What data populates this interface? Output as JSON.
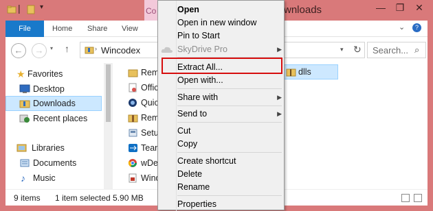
{
  "window": {
    "title": "Downloads",
    "title_visible_fragment": "wnloads",
    "context_tab_fragment": "Co"
  },
  "ribbon": {
    "tabs": [
      {
        "label": "File"
      },
      {
        "label": "Home"
      },
      {
        "label": "Share"
      },
      {
        "label": "View"
      }
    ]
  },
  "address": {
    "path": "Wincodex",
    "search_placeholder": "Search..."
  },
  "nav": {
    "favorites_label": "Favorites",
    "items": [
      {
        "label": "Desktop",
        "icon": "desktop-icon"
      },
      {
        "label": "Downloads",
        "icon": "downloads-folder-icon",
        "selected": true
      },
      {
        "label": "Recent places",
        "icon": "recent-places-icon"
      }
    ],
    "libraries_label": "Libraries",
    "library_items": [
      {
        "label": "Documents",
        "icon": "documents-icon"
      },
      {
        "label": "Music",
        "icon": "music-icon"
      }
    ]
  },
  "files": [
    {
      "label": "Rem",
      "icon": "folder-icon"
    },
    {
      "label": "Offic",
      "icon": "office-installer-icon"
    },
    {
      "label": "Quic",
      "icon": "quicktime-icon"
    },
    {
      "label": "Rem",
      "icon": "archive-icon"
    },
    {
      "label": "Setu",
      "icon": "setup-icon"
    },
    {
      "label": "Tean",
      "icon": "teamviewer-icon"
    },
    {
      "label": "wDe",
      "icon": "chrome-icon"
    },
    {
      "label": "Wind",
      "icon": "windows-installer-icon"
    }
  ],
  "selected_file": {
    "label": "dlls",
    "icon": "zip-folder-icon"
  },
  "status": {
    "items_count": "9 items",
    "selection": "1 item selected  5.90 MB"
  },
  "context_menu": {
    "items": [
      {
        "label": "Open",
        "bold": true
      },
      {
        "label": "Open in new window"
      },
      {
        "label": "Pin to Start"
      },
      {
        "label": "SkyDrive Pro",
        "disabled": true,
        "submenu": true
      },
      {
        "label": "Extract All...",
        "highlighted": true
      },
      {
        "label": "Open with..."
      },
      {
        "label": "Share with",
        "submenu": true
      },
      {
        "label": "Send to",
        "submenu": true
      },
      {
        "label": "Cut"
      },
      {
        "label": "Copy"
      },
      {
        "label": "Create shortcut"
      },
      {
        "label": "Delete"
      },
      {
        "label": "Rename"
      },
      {
        "label": "Properties"
      }
    ]
  },
  "colors": {
    "accent_file_tab": "#1979ca",
    "window_frame": "#d9797a",
    "highlight_border": "#d60c0c",
    "selection_bg": "#cce8ff"
  }
}
